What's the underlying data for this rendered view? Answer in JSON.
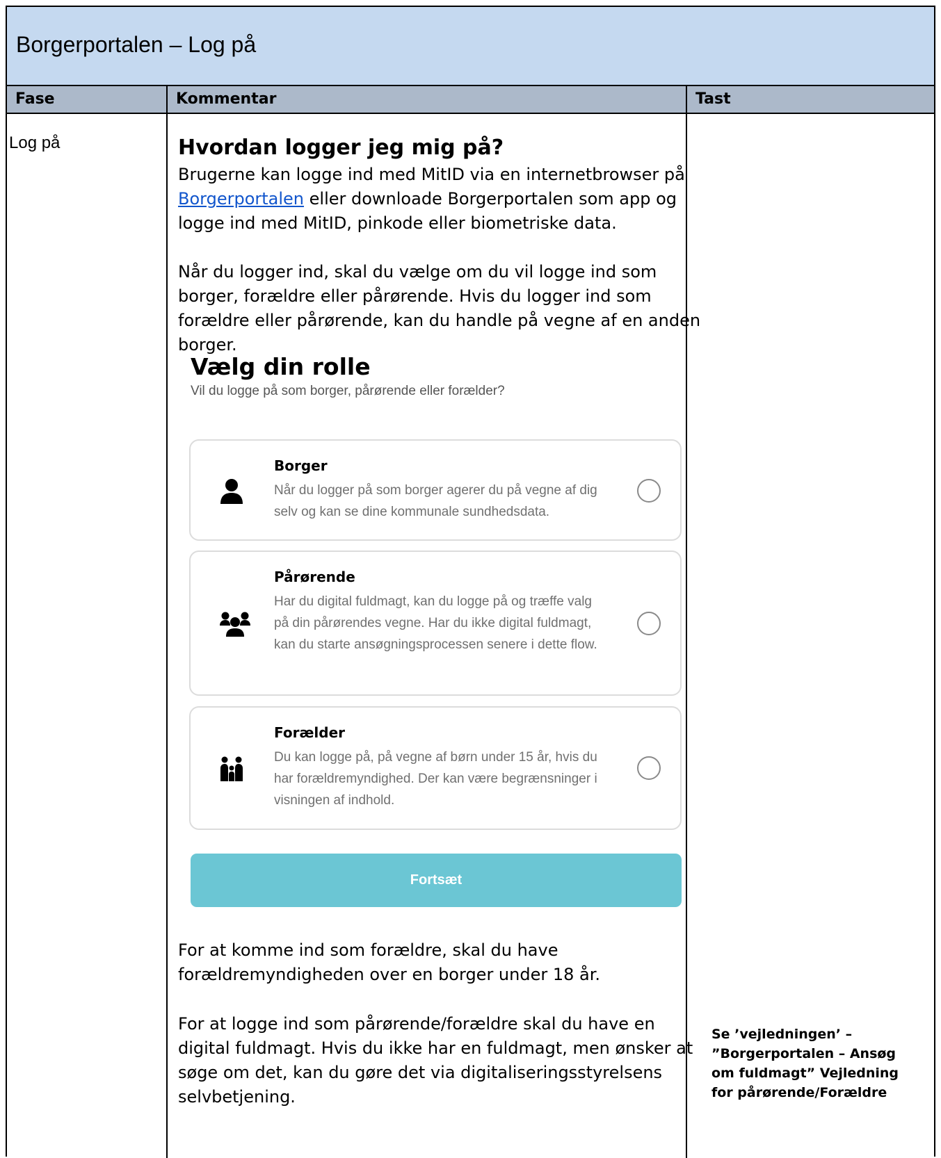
{
  "title": "Borgerportalen – Log på",
  "columns": {
    "fase": "Fase",
    "kommentar": "Kommentar",
    "tast": "Tast"
  },
  "row": {
    "fase": "Log på",
    "heading": "Hvordan logger jeg mig på?",
    "intro_before_link": "Brugerne kan logge ind med MitID via en internetbrowser på ",
    "intro_link": "Borgerportalen",
    "intro_after_link": " eller downloade Borgerportalen som app og logge ind med MitID, pinkode eller biometriske data.",
    "paragraph2": "Når du logger ind, skal du vælge om du vil logge ind som borger, forældre eller pårørende. Hvis du logger ind som forældre eller pårørende, kan du handle på vegne af en anden borger.",
    "screenshot": {
      "title": "Vælg din rolle",
      "subtitle": "Vil du logge på som borger, pårørende eller forælder?",
      "roles": [
        {
          "name": "Borger",
          "icon": "person-icon",
          "description": "Når du logger på som borger agerer du på vegne af dig selv og kan se dine kommunale sundhedsdata."
        },
        {
          "name": "Pårørende",
          "icon": "group-icon",
          "description": "Har du digital fuldmagt, kan du logge på og træffe valg på din pårørendes vegne. Har du ikke digital fuldmagt, kan du starte ansøgningsprocessen senere i dette flow."
        },
        {
          "name": "Forælder",
          "icon": "family-icon",
          "description": "Du kan logge på, på vegne af børn under 15 år, hvis du har forældremyndighed. Der kan være begrænsninger i visningen af indhold."
        }
      ],
      "button": "Fortsæt"
    },
    "paragraph3": "For at komme ind som forældre, skal du have forældremyndigheden over en borger under 18 år.",
    "paragraph4": "For at logge ind som pårørende/forældre skal du have en digital fuldmagt. Hvis du ikke har en fuldmagt, men ønsker at søge om det, kan du gøre det via digitaliseringsstyrelsens selvbetjening.",
    "tast_note": "Se ’vejledningen’ – ”Borgerportalen – Ansøg om fuldmagt” Vejledning for pårørende/Forældre"
  },
  "colors": {
    "title_bg": "#c5d9f0",
    "header_bg": "#acb9ca",
    "button_bg": "#6bc6d4",
    "link": "#1155cc"
  }
}
